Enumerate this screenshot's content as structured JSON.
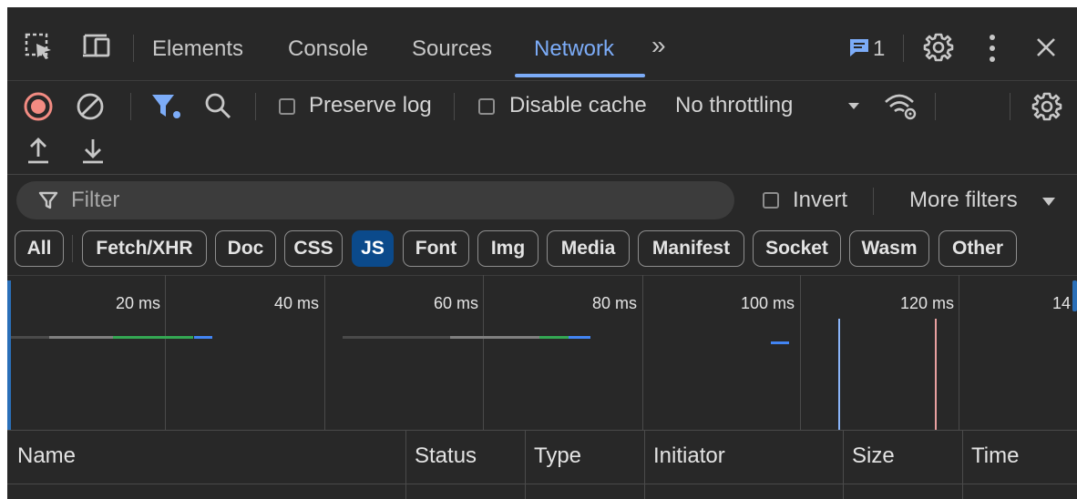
{
  "tabs": {
    "elements": "Elements",
    "console": "Console",
    "sources": "Sources",
    "network": "Network",
    "more": "»",
    "issues_count": "1"
  },
  "toolbar": {
    "preserve_log": "Preserve log",
    "disable_cache": "Disable cache",
    "throttling": "No throttling"
  },
  "filter": {
    "placeholder": "Filter",
    "invert": "Invert",
    "more_filters": "More filters"
  },
  "types": [
    "All",
    "Fetch/XHR",
    "Doc",
    "CSS",
    "JS",
    "Font",
    "Img",
    "Media",
    "Manifest",
    "Socket",
    "Wasm",
    "Other"
  ],
  "active_type": "JS",
  "overview": {
    "ticks": [
      "20 ms",
      "40 ms",
      "60 ms",
      "80 ms",
      "100 ms",
      "120 ms",
      "14"
    ]
  },
  "columns": [
    "Name",
    "Status",
    "Type",
    "Initiator",
    "Size",
    "Time"
  ],
  "colors": {
    "accent": "#7cacf8",
    "record_red": "#f28b82",
    "active_chip": "#0b4a8b",
    "bar_gray": "#808080",
    "bar_green": "#34a853",
    "bar_blue": "#4285f4",
    "marker_red": "#e8a0a0"
  },
  "icons": [
    "inspect-element-icon",
    "device-toolbar-icon",
    "issues-icon",
    "settings-icon",
    "kebab-menu-icon",
    "close-icon",
    "record-icon",
    "clear-icon",
    "filter-icon",
    "search-icon",
    "network-conditions-icon",
    "network-settings-icon",
    "import-har-icon",
    "export-har-icon",
    "filter-funnel-icon",
    "dropdown-caret-icon"
  ]
}
